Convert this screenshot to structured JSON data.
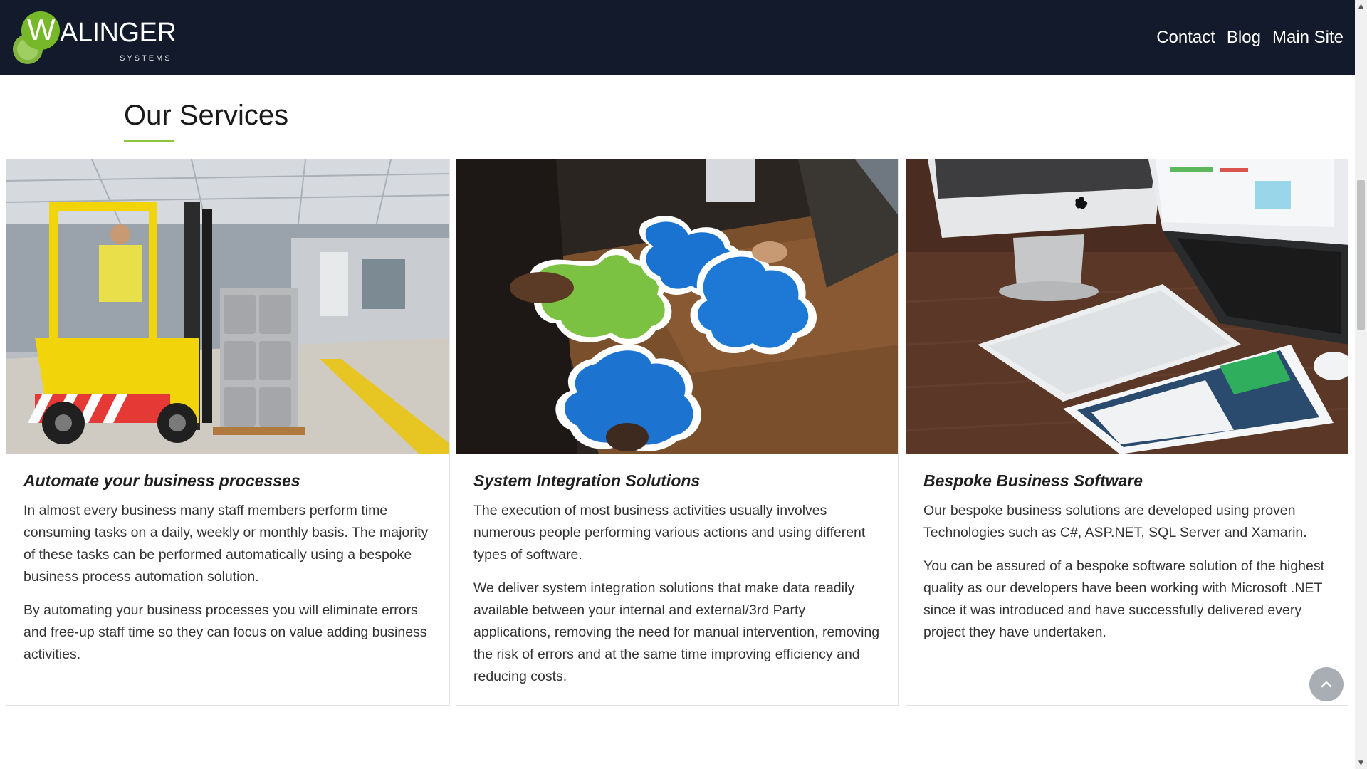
{
  "header": {
    "logo_letter": "W",
    "logo_text": "ALINGER",
    "logo_sub": "SYSTEMS",
    "nav": [
      "Contact",
      "Blog",
      "Main Site"
    ]
  },
  "section": {
    "title": "Our Services"
  },
  "cards": [
    {
      "image": "forklift-warehouse-photo",
      "title": "Automate your business processes",
      "paragraphs": [
        "In almost every business many staff members perform time consuming tasks on a daily, weekly or monthly basis. The majority of these tasks can be performed automatically using a bespoke business process automation solution.",
        "By automating your business processes you will eliminate errors and free-up staff time so they can focus on value adding business activities."
      ]
    },
    {
      "image": "puzzle-pieces-photo",
      "title": "System Integration Solutions",
      "paragraphs": [
        "The execution of most business activities usually involves numerous people performing various actions and using different types of software.",
        "We deliver system integration solutions that make data readily available between your internal and external/3rd Party applications, removing the need for manual intervention, removing the risk of errors and at the same time improving efficiency and reducing costs."
      ]
    },
    {
      "image": "computer-devices-photo",
      "title": "Bespoke Business Software",
      "paragraphs": [
        "Our bespoke business solutions are developed using proven Technologies such as C#, ASP.NET, SQL Server and Xamarin.",
        "You can be assured of a bespoke software solution of the highest quality as our developers have been working with Microsoft .NET since it was introduced and have successfully delivered every project they have undertaken."
      ]
    }
  ],
  "colors": {
    "header_bg": "#131a2b",
    "accent_green": "#8cc63f",
    "back_to_top": "#a8aeb4"
  },
  "icons": {
    "back_to_top": "chevron-up-icon",
    "scroll_up": "triangle-up-icon",
    "scroll_down": "triangle-down-icon"
  }
}
